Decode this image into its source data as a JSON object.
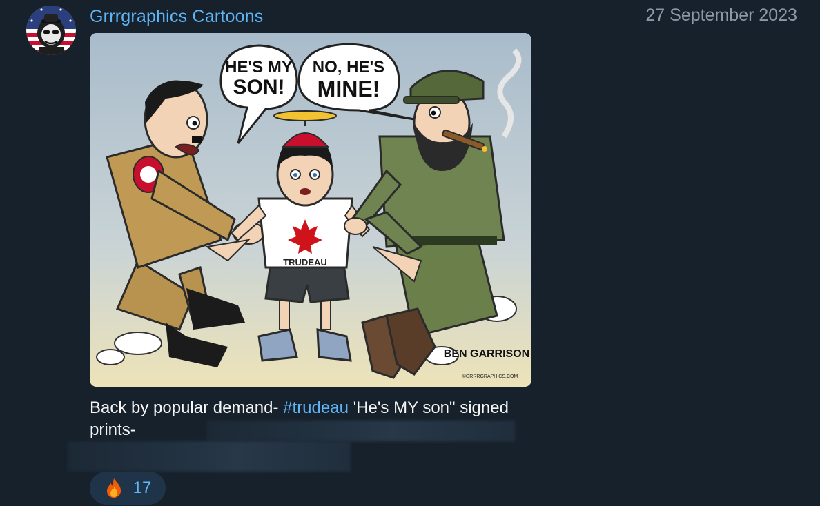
{
  "channel": {
    "name": "Grrrgraphics Cartoons",
    "avatar_icon": "cartoon-portrait-avatar"
  },
  "post": {
    "date": "27 September 2023",
    "image": {
      "bubble_left": "HE'S MY SON!",
      "bubble_right": "NO, HE'S MINE!",
      "shirt_text": "TRUDEAU",
      "signature": "BEN GARRISON",
      "signature_site": "©GRRRGRAPHICS.COM"
    },
    "caption": {
      "before": "Back by popular demand- ",
      "hashtag": "#trudeau",
      "after": " 'He's MY son\" signed prints-"
    },
    "reaction": {
      "icon": "fire-icon",
      "count": "17"
    }
  },
  "colors": {
    "background": "#17212b",
    "accent": "#5eb5f7",
    "muted": "#8b98a5",
    "reaction_bg": "#1f3349"
  }
}
